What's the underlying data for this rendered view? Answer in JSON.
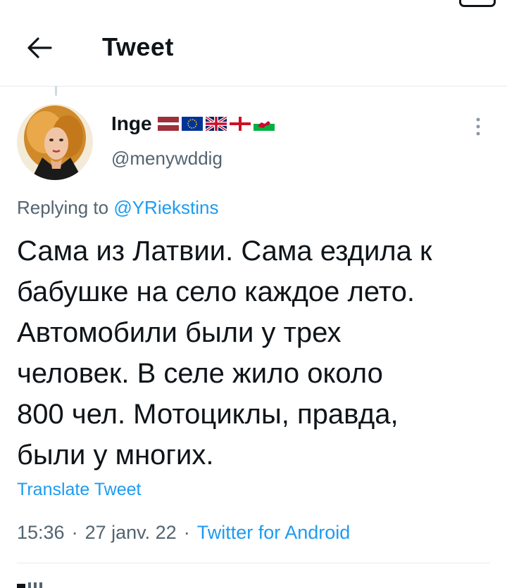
{
  "header": {
    "title": "Tweet"
  },
  "user": {
    "display_name": "Inge",
    "handle": "@menywddig",
    "flags": [
      "latvia-flag",
      "eu-flag",
      "uk-flag",
      "england-flag",
      "wales-flag"
    ]
  },
  "reply": {
    "prefix": "Replying to",
    "mention": "@YRiekstins"
  },
  "tweet": {
    "text": "Сама из Латвии. Сама ездила к\nбабушке на село каждое лето.\nАвтомобили были у трех\nчеловек. В селе жило около\n800 чел. Мотоциклы, правда,\nбыли у многих."
  },
  "translate_label": "Translate Tweet",
  "meta": {
    "time": "15:36",
    "separator": "·",
    "date": "27 janv. 22",
    "source": "Twitter for Android"
  },
  "colors": {
    "link": "#1d9bf0",
    "secondary": "#536471",
    "text": "#0f1419",
    "divider": "#e6ecf0"
  },
  "icons": {
    "back": "arrow-left-icon",
    "more": "more-vertical-icon"
  }
}
